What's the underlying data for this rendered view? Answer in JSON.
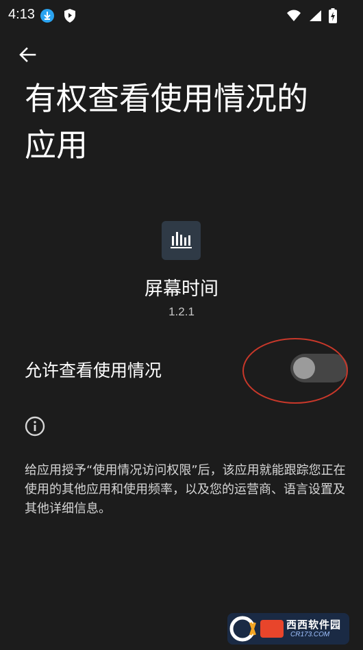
{
  "status_bar": {
    "time": "4:13",
    "left_icons": [
      "download-icon",
      "shield-icon"
    ],
    "right_icons": [
      "wifi-icon",
      "signal-icon",
      "battery-charging-icon"
    ]
  },
  "header": {
    "back_icon": "arrow-back-icon",
    "title": "有权查看使用情况的应用"
  },
  "app": {
    "icon": "bar-chart-icon",
    "name": "屏幕时间",
    "version": "1.2.1"
  },
  "permission": {
    "label": "允许查看使用情况",
    "enabled": false
  },
  "info": {
    "icon": "info-icon",
    "text": "给应用授予“使用情况访问权限”后，该应用就能跟踪您正在使用的其他应用和使用频率，以及您的运营商、语言设置及其他详细信息。"
  },
  "watermark": {
    "brand": "西西软件园",
    "url": "CR173.COM"
  },
  "colors": {
    "background": "#1c1c1c",
    "annotation": "#c9382a",
    "toggle_track": "#454545",
    "toggle_knob": "#9b9b9b"
  }
}
